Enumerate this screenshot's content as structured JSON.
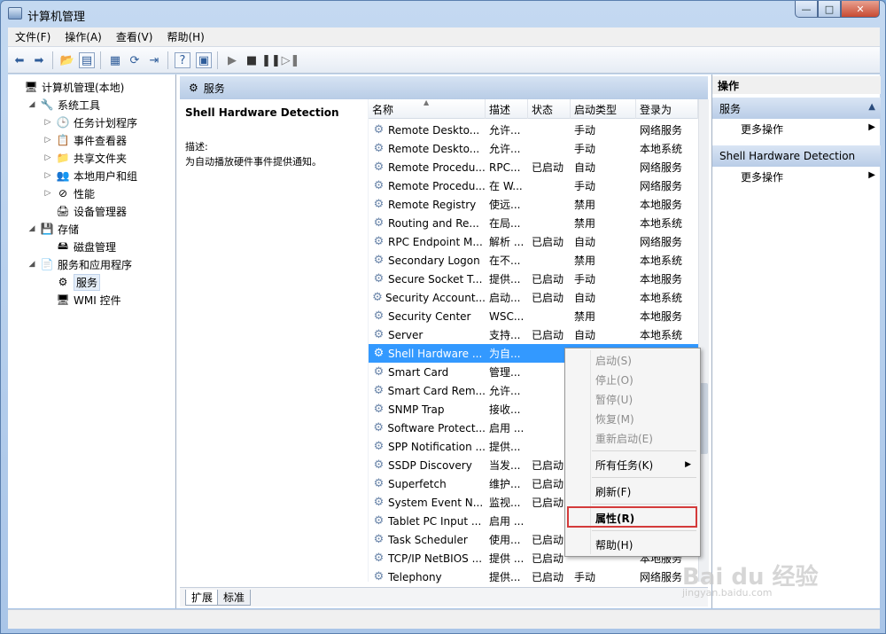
{
  "window": {
    "title": "计算机管理",
    "btn_min": "—",
    "btn_max": "□",
    "btn_close": "✕"
  },
  "menu": [
    "文件(F)",
    "操作(A)",
    "查看(V)",
    "帮助(H)"
  ],
  "tree": [
    {
      "label": "计算机管理(本地)",
      "indent": 0,
      "expander": "",
      "icon": "🖥"
    },
    {
      "label": "系统工具",
      "indent": 1,
      "expander": "◢",
      "icon": "🔧"
    },
    {
      "label": "任务计划程序",
      "indent": 2,
      "expander": "▷",
      "icon": "🕒"
    },
    {
      "label": "事件查看器",
      "indent": 2,
      "expander": "▷",
      "icon": "📋"
    },
    {
      "label": "共享文件夹",
      "indent": 2,
      "expander": "▷",
      "icon": "📁"
    },
    {
      "label": "本地用户和组",
      "indent": 2,
      "expander": "▷",
      "icon": "👥"
    },
    {
      "label": "性能",
      "indent": 2,
      "expander": "▷",
      "icon": "⊘"
    },
    {
      "label": "设备管理器",
      "indent": 2,
      "expander": "",
      "icon": "🖨"
    },
    {
      "label": "存储",
      "indent": 1,
      "expander": "◢",
      "icon": "💾"
    },
    {
      "label": "磁盘管理",
      "indent": 2,
      "expander": "",
      "icon": "🖴"
    },
    {
      "label": "服务和应用程序",
      "indent": 1,
      "expander": "◢",
      "icon": "📄"
    },
    {
      "label": "服务",
      "indent": 2,
      "expander": "",
      "icon": "⚙",
      "selected": true
    },
    {
      "label": "WMI 控件",
      "indent": 2,
      "expander": "",
      "icon": "🖥"
    }
  ],
  "middle": {
    "header": "服务",
    "desc_title": "Shell Hardware Detection",
    "desc_label": "描述:",
    "desc_text": "为自动播放硬件事件提供通知。",
    "columns": [
      "名称",
      "描述",
      "状态",
      "启动类型",
      "登录为"
    ],
    "rows": [
      [
        "Remote Deskto...",
        "允许...",
        "",
        "手动",
        "网络服务"
      ],
      [
        "Remote Deskto...",
        "允许...",
        "",
        "手动",
        "本地系统"
      ],
      [
        "Remote Procedu...",
        "RPC...",
        "已启动",
        "自动",
        "网络服务"
      ],
      [
        "Remote Procedu...",
        "在 W...",
        "",
        "手动",
        "网络服务"
      ],
      [
        "Remote Registry",
        "使远...",
        "",
        "禁用",
        "本地服务"
      ],
      [
        "Routing and Re...",
        "在局...",
        "",
        "禁用",
        "本地系统"
      ],
      [
        "RPC Endpoint M...",
        "解析 ...",
        "已启动",
        "自动",
        "网络服务"
      ],
      [
        "Secondary Logon",
        "在不...",
        "",
        "禁用",
        "本地系统"
      ],
      [
        "Secure Socket T...",
        "提供...",
        "已启动",
        "手动",
        "本地服务"
      ],
      [
        "Security Account...",
        "启动...",
        "已启动",
        "自动",
        "本地系统"
      ],
      [
        "Security Center",
        "WSC...",
        "",
        "禁用",
        "本地服务"
      ],
      [
        "Server",
        "支持...",
        "已启动",
        "自动",
        "本地系统"
      ],
      [
        "Shell Hardware ...",
        "为自...",
        "",
        "",
        ""
      ],
      [
        "Smart Card",
        "管理...",
        "",
        "",
        ""
      ],
      [
        "Smart Card Rem...",
        "允许...",
        "",
        "",
        ""
      ],
      [
        "SNMP Trap",
        "接收...",
        "",
        "",
        ""
      ],
      [
        "Software Protect...",
        "启用 ...",
        "",
        "",
        ""
      ],
      [
        "SPP Notification ...",
        "提供...",
        "",
        "",
        ""
      ],
      [
        "SSDP Discovery",
        "当发...",
        "已启动",
        "",
        ""
      ],
      [
        "Superfetch",
        "维护...",
        "已启动",
        "",
        ""
      ],
      [
        "System Event N...",
        "监视...",
        "已启动",
        "",
        ""
      ],
      [
        "Tablet PC Input ...",
        "启用 ...",
        "",
        "",
        ""
      ],
      [
        "Task Scheduler",
        "使用...",
        "已启动",
        "",
        ""
      ],
      [
        "TCP/IP NetBIOS ...",
        "提供 ...",
        "已启动",
        "",
        "本地服务"
      ],
      [
        "Telephony",
        "提供...",
        "已启动",
        "手动",
        "网络服务"
      ]
    ],
    "selected_row": 12,
    "tabs": [
      "扩展",
      "标准"
    ]
  },
  "actions": {
    "title": "操作",
    "sections": [
      {
        "title": "服务",
        "item": "更多操作"
      },
      {
        "title": "Shell Hardware Detection",
        "item": "更多操作"
      }
    ],
    "caret": "▲",
    "arrow": "▶"
  },
  "context_menu": {
    "items": [
      {
        "label": "启动(S)",
        "disabled": true
      },
      {
        "label": "停止(O)",
        "disabled": true
      },
      {
        "label": "暂停(U)",
        "disabled": true
      },
      {
        "label": "恢复(M)",
        "disabled": true
      },
      {
        "label": "重新启动(E)",
        "disabled": true
      },
      {
        "sep": true
      },
      {
        "label": "所有任务(K)",
        "submenu": true
      },
      {
        "sep": true
      },
      {
        "label": "刷新(F)"
      },
      {
        "sep": true
      },
      {
        "label": "属性(R)",
        "bold": true
      },
      {
        "sep": true
      },
      {
        "label": "帮助(H)"
      }
    ],
    "highlight_color": "#d43b3b"
  },
  "watermark": {
    "main": "Bai du 经验",
    "sub": "jingyan.baidu.com"
  }
}
